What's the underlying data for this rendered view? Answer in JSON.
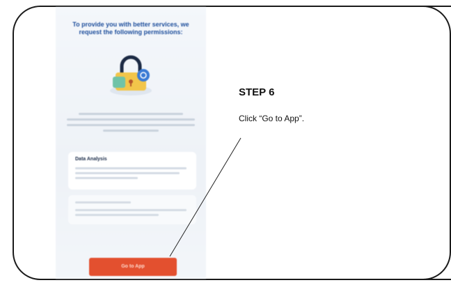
{
  "phone": {
    "header": "To provide you with better services, we request the following permissions:",
    "card_title": "Data Analysis",
    "button_label": "Go to App"
  },
  "step": {
    "title": "STEP 6",
    "instruction": "Click “Go to App”."
  },
  "colors": {
    "accent_button": "#e3502f",
    "header_text": "#1f4f9c",
    "frame": "#1a1a1a"
  },
  "icons": {
    "lock": "padlock-icon"
  }
}
